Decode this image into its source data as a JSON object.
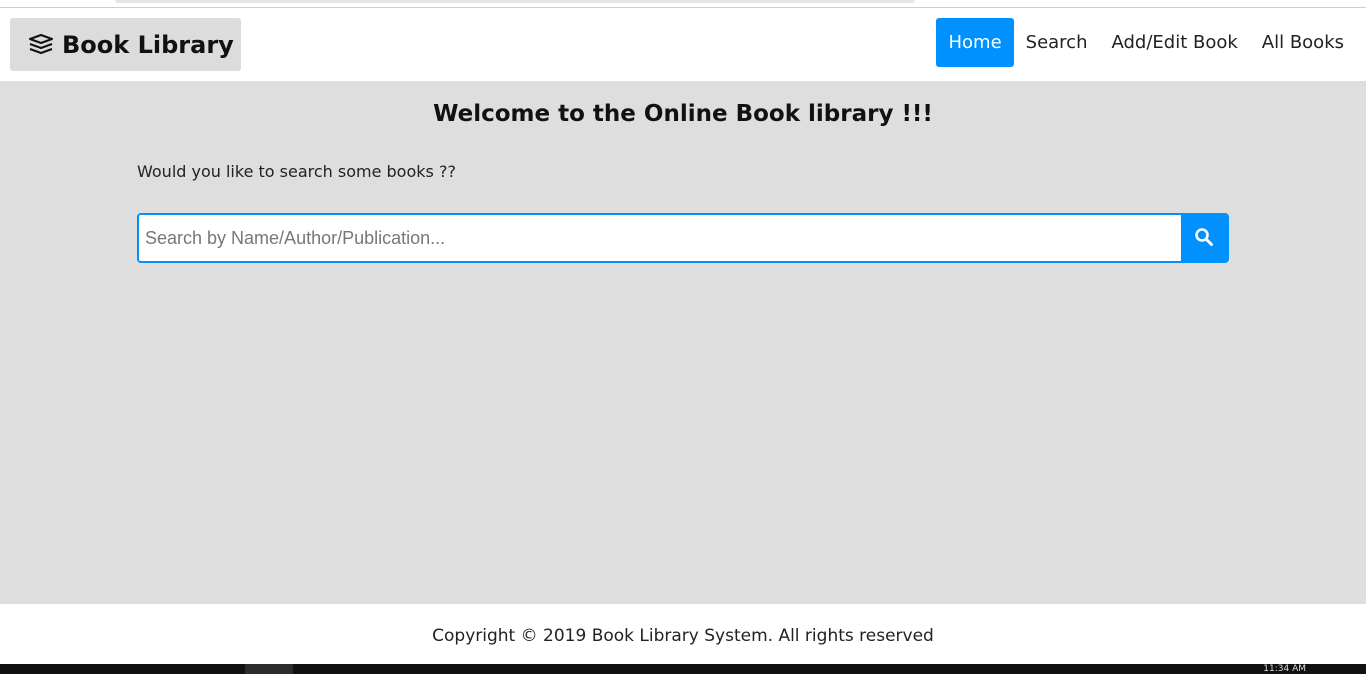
{
  "brand": {
    "title": "Book Library",
    "icon": "books-stack-icon"
  },
  "nav": {
    "items": [
      {
        "label": "Home",
        "active": true
      },
      {
        "label": "Search",
        "active": false
      },
      {
        "label": "Add/Edit Book",
        "active": false
      },
      {
        "label": "All Books",
        "active": false
      }
    ]
  },
  "main": {
    "heading": "Welcome to the Online Book library !!!",
    "prompt": "Would you like to search some books ??",
    "search": {
      "placeholder": "Search by Name/Author/Publication...",
      "value": "",
      "button_icon": "search-icon"
    }
  },
  "footer": {
    "text": "Copyright © 2019 Book Library System. All rights reserved"
  },
  "taskbar": {
    "clock": "11:34 AM"
  },
  "colors": {
    "accent": "#0091ff",
    "page_bg": "#dedede",
    "brand_bg": "#dcdcdc"
  }
}
